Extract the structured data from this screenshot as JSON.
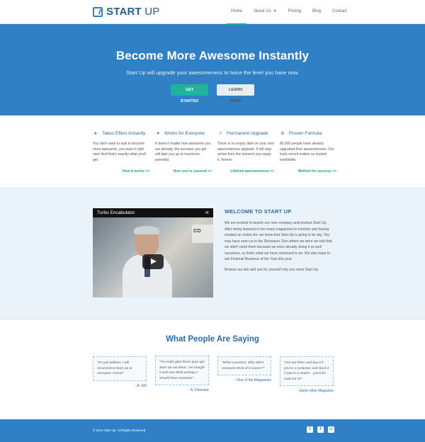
{
  "header": {
    "logo_bold": "START",
    "logo_light": " UP",
    "nav": [
      {
        "label": "Home"
      },
      {
        "label": "About Us"
      },
      {
        "label": "Pricing"
      },
      {
        "label": "Blog"
      },
      {
        "label": "Contact"
      }
    ],
    "active_nav": "Home"
  },
  "hero": {
    "title": "Become More Awesome Instantly",
    "subtitle": "Start Up will upgrade your awesomeness to twice the level you have now.",
    "primary_button": "GET STARTED",
    "secondary_button": "LEARN MORE"
  },
  "features": [
    {
      "icon": "send-icon",
      "title": "Takes Effect Instantly",
      "text": "You don't want to wait to become more awesome, you want it right now! And that's exactly what you'll get.",
      "link": "How it works >>"
    },
    {
      "icon": "heart-icon",
      "title": "Works for Everyone",
      "text": "It doesn't matter how awesome you are already, the increase you get will take you up to maximum potential.",
      "link": "How you're covered >>"
    },
    {
      "icon": "chart-icon",
      "title": "Permanent Upgrade",
      "text": "There is no expiry date on your new awesomeness upgrade. It will stay active from the moment you equip it, forever.",
      "link": "Lifetime awesomeness >>"
    },
    {
      "icon": "gears-icon",
      "title": "Proven Formula",
      "text": "80,000 people have already upgraded their awesomeness. Our track record makes us trusted worldwide.",
      "link": "Method for success >>"
    }
  ],
  "welcome": {
    "video_title": "Turbo Encabulator",
    "video_sign": "CO",
    "heading": "WELCOME TO START UP",
    "paragraph1": "We are excited to launch our new company and product Start Up. After being featured in too many magazines to mention and having created an online stir, we know that Start Up is going to be big. You may have seen us in the Dinosaurs' Den where we were we told that we didn't need them because we were already doing it so well ourselves, so that's what we have continued to do. We also hope to win Fictional Business of the Year this year.",
    "paragraph2": "Browse our site and see for yourself why you need Start Up."
  },
  "testimonials": {
    "heading": "What People Are Saying",
    "items": [
      {
        "quote": "\"It's just brilliant. I will recommend Start Up to everyone I know!\"",
        "author": "- A. Girl"
      },
      {
        "quote": "\"I'm really glad these guys got Start Up out there. I've bought it and now think perhaps I should have invested!\"",
        "author": "- A. Dinosaur"
      },
      {
        "quote": "\"What a product. Why didn't someone think of it sooner?\"",
        "author": "- One of the Magazines"
      },
      {
        "quote": "\"Get out there and buy it if you're a customer and stock it if you're a retailer - you'd be mad not to!\"",
        "author": "- Some other Magazine"
      }
    ]
  },
  "footer": {
    "copyright": "© 2014 Start Up. All Rights Reserved.",
    "social": [
      "twitter-icon",
      "facebook-icon",
      "instagram-icon"
    ]
  },
  "colors": {
    "primary": "#2f80c4",
    "accent": "#1fb39b",
    "heading": "#2b69a3"
  }
}
